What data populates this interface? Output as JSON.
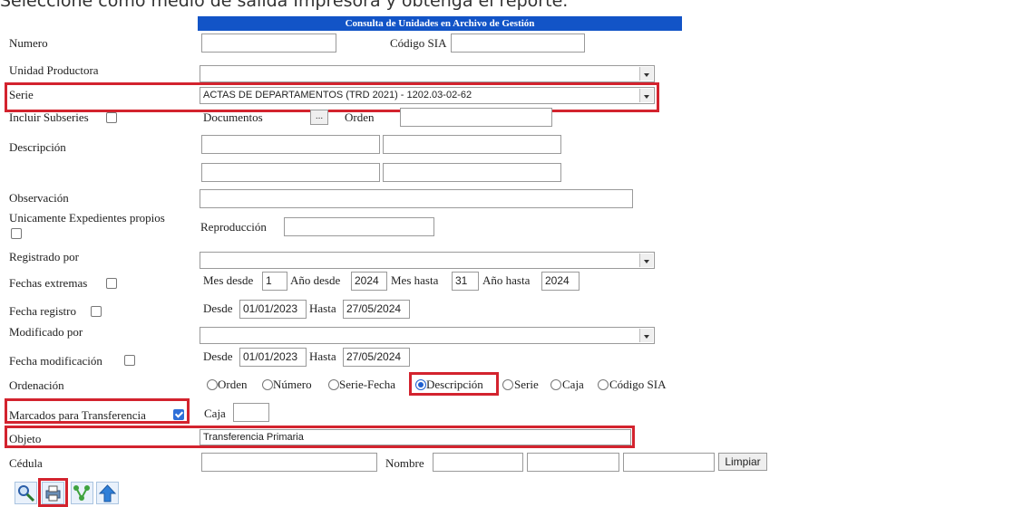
{
  "instruction_top": "Seleccione como medio de salida Impresora y obtenga el reporte.",
  "header_title": "Consulta de Unidades en Archivo de Gestión",
  "labels": {
    "numero": "Numero",
    "codigo_sia": "Código SIA",
    "unidad_productora": "Unidad Productora",
    "serie": "Serie",
    "incluir_subseries": "Incluir Subseries",
    "documentos": "Documentos",
    "orden": "Orden",
    "descripcion": "Descripción",
    "observacion": "Observación",
    "unicamente": "Unicamente Expedientes propios",
    "reproduccion": "Reproducción",
    "registrado_por": "Registrado por",
    "fechas_extremas": "Fechas extremas",
    "mes_desde": "Mes desde",
    "anio_desde": "Año desde",
    "mes_hasta": "Mes hasta",
    "anio_hasta": "Año hasta",
    "fecha_registro": "Fecha registro",
    "desde": "Desde",
    "hasta": "Hasta",
    "modificado_por": "Modificado por",
    "fecha_modificacion": "Fecha modificación",
    "ordenacion": "Ordenación",
    "marcados": "Marcados para Transferencia",
    "caja": "Caja",
    "objeto": "Objeto",
    "cedula": "Cédula",
    "nombre": "Nombre"
  },
  "values": {
    "serie_selected": "ACTAS DE DEPARTAMENTOS (TRD 2021) - 1202.03-02-62",
    "documentos_btn": "...",
    "mes_desde": "1",
    "anio_desde": "2024",
    "mes_hasta": "31",
    "anio_hasta": "2024",
    "registro_desde": "01/01/2023",
    "registro_hasta": "27/05/2024",
    "modif_desde": "01/01/2023",
    "modif_hasta": "27/05/2024",
    "objeto": "Transferencia Primaria",
    "limpiar": "Limpiar"
  },
  "ordenacion_options": [
    "Orden",
    "Número",
    "Serie-Fecha",
    "Descripción",
    "Serie",
    "Caja",
    "Código SIA"
  ],
  "ordenacion_selected": "Descripción",
  "checkboxes": {
    "incluir_subseries": false,
    "unicamente": false,
    "fechas_extremas": false,
    "fecha_registro": false,
    "fecha_modificacion": false,
    "marcados": true
  },
  "toolbar_icons": [
    "search-icon",
    "printer-icon",
    "network-icon",
    "upload-arrow-icon"
  ],
  "colors": {
    "header_bg": "#1254c7",
    "highlight": "#d3232e",
    "checkbox": "#2e6fd8"
  }
}
